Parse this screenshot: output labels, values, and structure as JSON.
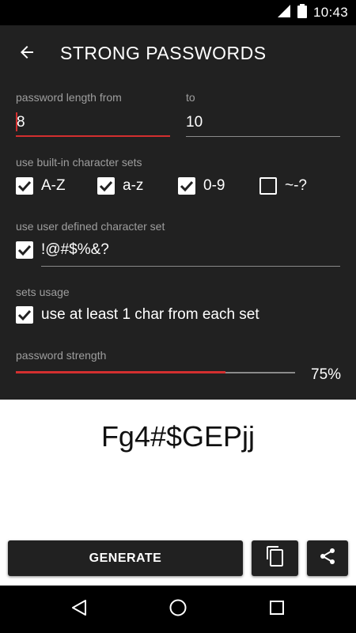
{
  "status_bar": {
    "time": "10:43"
  },
  "app_bar": {
    "title": "STRONG PASSWORDS"
  },
  "length": {
    "from_label": "password length from",
    "from_value": "8",
    "to_label": "to",
    "to_value": "10"
  },
  "builtin_sets": {
    "label": "use built-in character sets",
    "items": [
      {
        "label": "A-Z",
        "checked": true
      },
      {
        "label": "a-z",
        "checked": true
      },
      {
        "label": "0-9",
        "checked": true
      },
      {
        "label": "~-?",
        "checked": false
      }
    ]
  },
  "user_set": {
    "label": "use user defined character set",
    "checked": true,
    "value": "!@#$%&?"
  },
  "sets_usage": {
    "label": "sets usage",
    "option_label": "use at least 1 char from each set",
    "checked": true
  },
  "strength": {
    "label": "password strength",
    "percent_text": "75%",
    "value": 0.75
  },
  "output": {
    "password": "Fg4#$GEPjj"
  },
  "actions": {
    "generate_label": "GENERATE"
  },
  "colors": {
    "accent": "#d32f2f",
    "panel": "#212121",
    "status_bar": "#000000"
  },
  "icons": [
    "wifi-icon",
    "battery-icon",
    "back-arrow-icon",
    "copy-icon",
    "share-icon",
    "nav-back-icon",
    "nav-home-icon",
    "nav-recents-icon"
  ]
}
